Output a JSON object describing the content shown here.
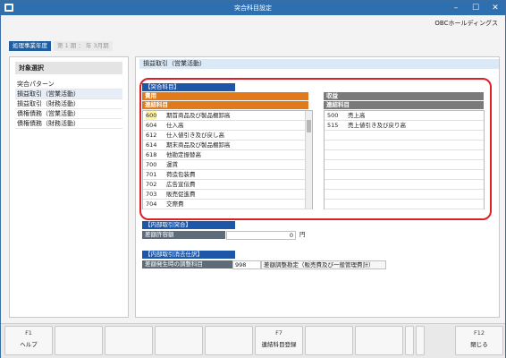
{
  "window": {
    "title": "突合科目設定",
    "company": "OBCホールディングス"
  },
  "period": {
    "label": "処理事業年度",
    "value": "第 1 期 ：    年  3月期"
  },
  "left": {
    "header": "対象選択",
    "items": [
      "突合パターン",
      "損益取引（営業活動）",
      "損益取引（財務活動）",
      "債権債務（営業活動）",
      "債権債務（財務活動）"
    ]
  },
  "main": {
    "section_title": "損益取引（営業活動）",
    "match_header": "【突合科目】",
    "expense": {
      "label": "費用",
      "sub": "連結科目",
      "rows": [
        {
          "code": "600",
          "name": "期首商品及び製品棚卸高"
        },
        {
          "code": "604",
          "name": "仕入高"
        },
        {
          "code": "612",
          "name": "仕入値引き及び戻し高"
        },
        {
          "code": "614",
          "name": "期末商品及び製品棚卸高"
        },
        {
          "code": "618",
          "name": "他勘定振替高"
        },
        {
          "code": "700",
          "name": "運賃"
        },
        {
          "code": "701",
          "name": "荷造包装費"
        },
        {
          "code": "702",
          "name": "広告宣伝費"
        },
        {
          "code": "703",
          "name": "販売促進費"
        },
        {
          "code": "704",
          "name": "交際費"
        }
      ]
    },
    "revenue": {
      "label": "収益",
      "sub": "連結科目",
      "rows": [
        {
          "code": "500",
          "name": "売上高"
        },
        {
          "code": "515",
          "name": "売上値引き及び戻り高"
        }
      ]
    },
    "internal_match": {
      "header": "【内部取引突合】",
      "label": "差額許容額",
      "value": "0",
      "unit": "円"
    },
    "internal_elim": {
      "header": "【内部取引消去仕訳】",
      "label": "差額発生時の調整科目",
      "code": "998",
      "name": "差額調整勘定（販売費及び一般管理費計）"
    }
  },
  "fkeys": [
    {
      "key": "F1",
      "label": "ヘルプ"
    },
    {
      "key": "",
      "label": ""
    },
    {
      "key": "",
      "label": ""
    },
    {
      "key": "",
      "label": ""
    },
    {
      "key": "",
      "label": ""
    },
    {
      "key": "F7",
      "label": "連結科目登録"
    },
    {
      "key": "",
      "label": ""
    },
    {
      "key": "",
      "label": ""
    },
    {
      "key": "",
      "label": ""
    },
    {
      "key": "",
      "label": ""
    },
    {
      "key": "F12",
      "label": "閉じる"
    }
  ]
}
